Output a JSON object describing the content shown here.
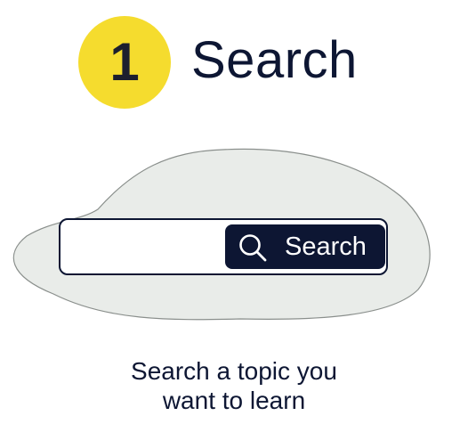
{
  "step": {
    "number": "1",
    "title": "Search",
    "badge_color": "#f5dc2e"
  },
  "search": {
    "value": "",
    "placeholder": "",
    "button_label": "Search",
    "button_icon": "search-icon",
    "button_color": "#0d1633"
  },
  "caption": {
    "line1": "Search a topic you",
    "line2": "want to learn"
  },
  "colors": {
    "text": "#0d1633",
    "blob_fill": "#e9ece9",
    "blob_stroke": "#8a8f8c"
  }
}
